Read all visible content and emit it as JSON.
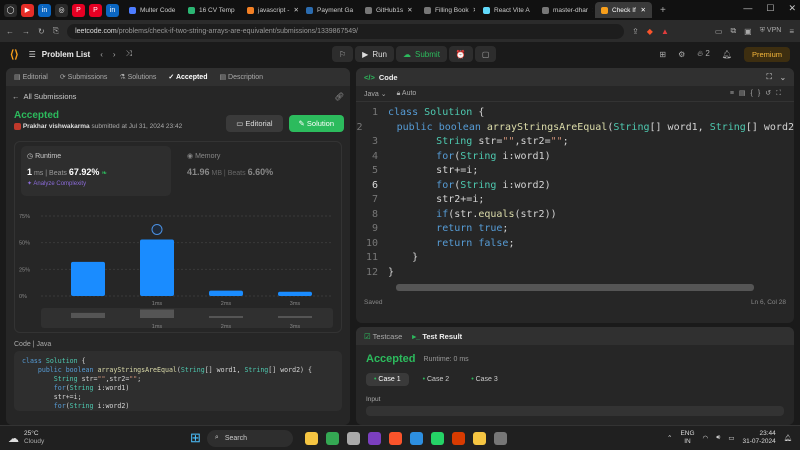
{
  "browser": {
    "pinned": [
      "github",
      "youtube",
      "linkedin",
      "chatgpt",
      "pinterest",
      "pinterest2",
      "linkedin2"
    ],
    "tabs": [
      {
        "label": "Multer Code",
        "color": "#4d7cff",
        "active": false
      },
      {
        "label": "16 CV Temp",
        "color": "#2bb673",
        "active": false
      },
      {
        "label": "javascript - ",
        "color": "#f48024",
        "active": false
      },
      {
        "label": "Payment Ga",
        "color": "#2b6cb0",
        "active": false
      },
      {
        "label": "GitHub1s",
        "color": "#777",
        "active": false
      },
      {
        "label": "Filling Book",
        "color": "#777",
        "active": false
      },
      {
        "label": "React Vite A",
        "color": "#61dafb",
        "active": false
      },
      {
        "label": "master-dhar",
        "color": "#777",
        "active": false
      },
      {
        "label": "Check If",
        "color": "#f89f1b",
        "active": true
      }
    ],
    "new_tab": "+",
    "url_host": "leetcode.com",
    "url_path": "/problems/check-if-two-string-arrays-are-equivalent/submissions/1339867549/",
    "vpn": "VPN"
  },
  "header": {
    "problem_list": "Problem List",
    "run": "Run",
    "submit": "Submit",
    "streak": "2",
    "premium": "Premium"
  },
  "left_tabs": [
    "Editorial",
    "Submissions",
    "Solutions",
    "Accepted",
    "Description"
  ],
  "submission": {
    "back": "All Submissions",
    "status": "Accepted",
    "user": "Prakhar vishwakarma",
    "meta": "submitted at Jul 31, 2024 23:42",
    "editorial_btn": "Editorial",
    "solution_btn": "Solution",
    "runtime_label": "Runtime",
    "runtime_value": "1",
    "runtime_unit": "ms",
    "beats_label": "Beats",
    "runtime_beats": "67.92%",
    "analyze": "Analyze Complexity",
    "memory_label": "Memory",
    "memory_value": "41.96",
    "memory_unit": "MB",
    "memory_beats": "6.60%"
  },
  "chart_data": {
    "type": "bar",
    "categories": [
      "",
      "1ms",
      "2ms",
      "3ms"
    ],
    "values": [
      32,
      53,
      5,
      4
    ],
    "ylim": [
      0,
      75
    ],
    "yticks": [
      "75%",
      "50%",
      "25%",
      "0%"
    ],
    "highlight_index": 1
  },
  "code_section": {
    "label": "Code",
    "lang": "Java",
    "lines": [
      "class Solution {",
      "    public boolean arrayStringsAreEqual(String[] word1, String[] word2) {",
      "        String str=\"\",str2=\"\";",
      "        for(String i:word1)",
      "        str+=i;",
      "        for(String i:word2)"
    ]
  },
  "editor": {
    "title": "Code",
    "lang": "Java",
    "auto": "Auto",
    "saved": "Saved",
    "cursor": "Ln 6, Col 28",
    "lines": [
      "class Solution {",
      "    public boolean arrayStringsAreEqual(String[] word1, String[] word2",
      "        String str=\"\",str2=\"\";",
      "        for(String i:word1)",
      "        str+=i;",
      "        for(String i:word2)",
      "        str2+=i;",
      "        if(str.equals(str2))",
      "        return true;",
      "        return false;",
      "    }",
      "}"
    ]
  },
  "test": {
    "tab1": "Testcase",
    "tab2": "Test Result",
    "status": "Accepted",
    "runtime": "Runtime: 0 ms",
    "cases": [
      "Case 1",
      "Case 2",
      "Case 3"
    ],
    "input_label": "Input"
  },
  "taskbar": {
    "temp": "25°C",
    "weather": "Cloudy",
    "search": "Search",
    "lang1": "ENG",
    "lang2": "IN",
    "time": "23:44",
    "date": "31-07-2024"
  }
}
